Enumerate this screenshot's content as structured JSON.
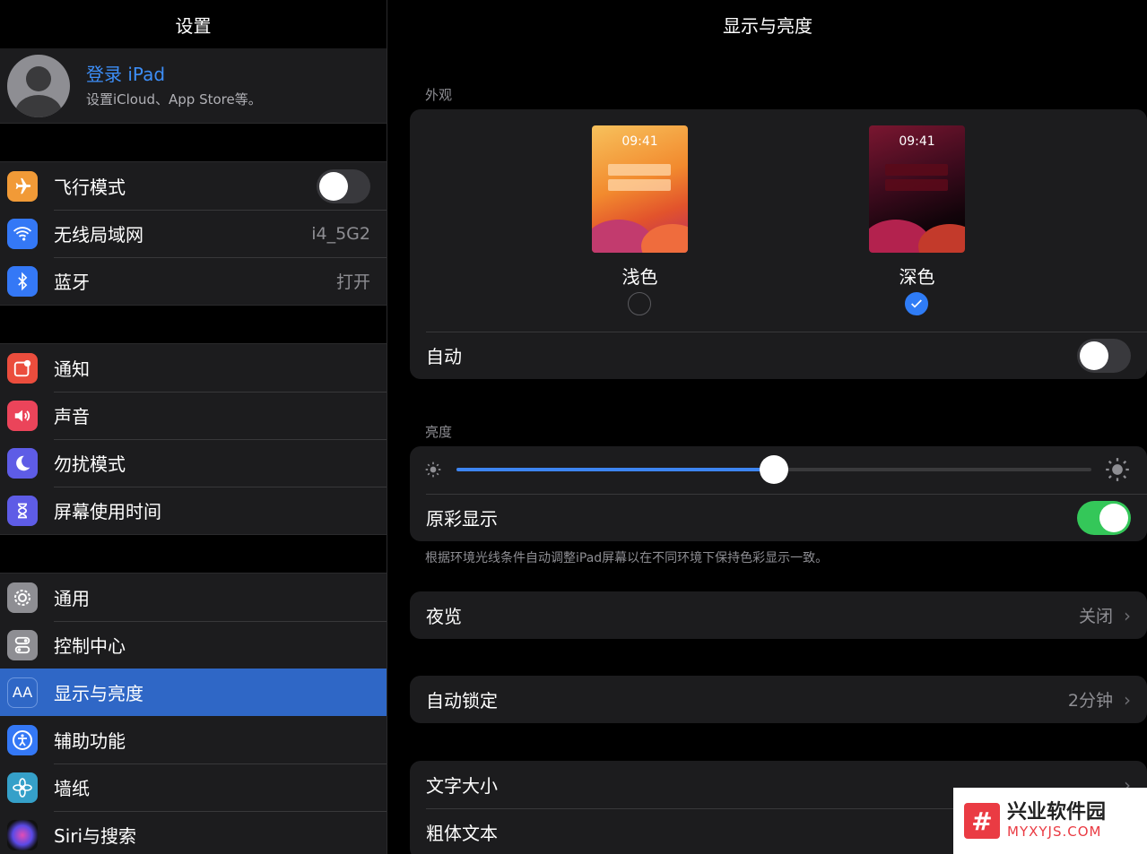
{
  "sidebar": {
    "title": "设置",
    "profile": {
      "title": "登录 iPad",
      "subtitle": "设置iCloud、App Store等。"
    },
    "group1": [
      {
        "label": "飞行模式",
        "icon": "airplane-icon",
        "color": "#f19a37"
      },
      {
        "label": "无线局域网",
        "value": "i4_5G2",
        "icon": "wifi-icon",
        "color": "#3478f6"
      },
      {
        "label": "蓝牙",
        "value": "打开",
        "icon": "bluetooth-icon",
        "color": "#3478f6"
      }
    ],
    "group2": [
      {
        "label": "通知",
        "icon": "notification-icon",
        "color": "#eb4d3d"
      },
      {
        "label": "声音",
        "icon": "speaker-icon",
        "color": "#eb445a"
      },
      {
        "label": "勿扰模式",
        "icon": "moon-icon",
        "color": "#5e5ce6"
      },
      {
        "label": "屏幕使用时间",
        "icon": "hourglass-icon",
        "color": "#5e5ce6"
      }
    ],
    "group3": [
      {
        "label": "通用",
        "icon": "gear-icon",
        "color": "#8e8e93"
      },
      {
        "label": "控制中心",
        "icon": "switches-icon",
        "color": "#8e8e93"
      },
      {
        "label": "显示与亮度",
        "icon": "text-size-icon",
        "icon_text": "AA",
        "color": "#2f67c6",
        "selected": true
      },
      {
        "label": "辅助功能",
        "icon": "accessibility-icon",
        "color": "#3478f6"
      },
      {
        "label": "墙纸",
        "icon": "flower-icon",
        "color": "#35a0c9"
      },
      {
        "label": "Siri与搜索",
        "icon": "siri-icon",
        "color": "#222"
      }
    ],
    "airplane_mode_on": false
  },
  "main": {
    "title": "显示与亮度",
    "appearance": {
      "section": "外观",
      "time": "09:41",
      "light_label": "浅色",
      "dark_label": "深色",
      "selected": "dark",
      "auto_label": "自动",
      "auto_on": false
    },
    "brightness": {
      "section": "亮度",
      "level": 0.5,
      "true_tone_label": "原彩显示",
      "true_tone_on": true,
      "footnote": "根据环境光线条件自动调整iPad屏幕以在不同环境下保持色彩显示一致。"
    },
    "night_shift": {
      "label": "夜览",
      "value": "关闭"
    },
    "auto_lock": {
      "label": "自动锁定",
      "value": "2分钟"
    },
    "text": {
      "size_label": "文字大小",
      "bold_label": "粗体文本"
    }
  },
  "watermark": {
    "cn": "兴业软件园",
    "en": "MYXYJS.COM"
  }
}
